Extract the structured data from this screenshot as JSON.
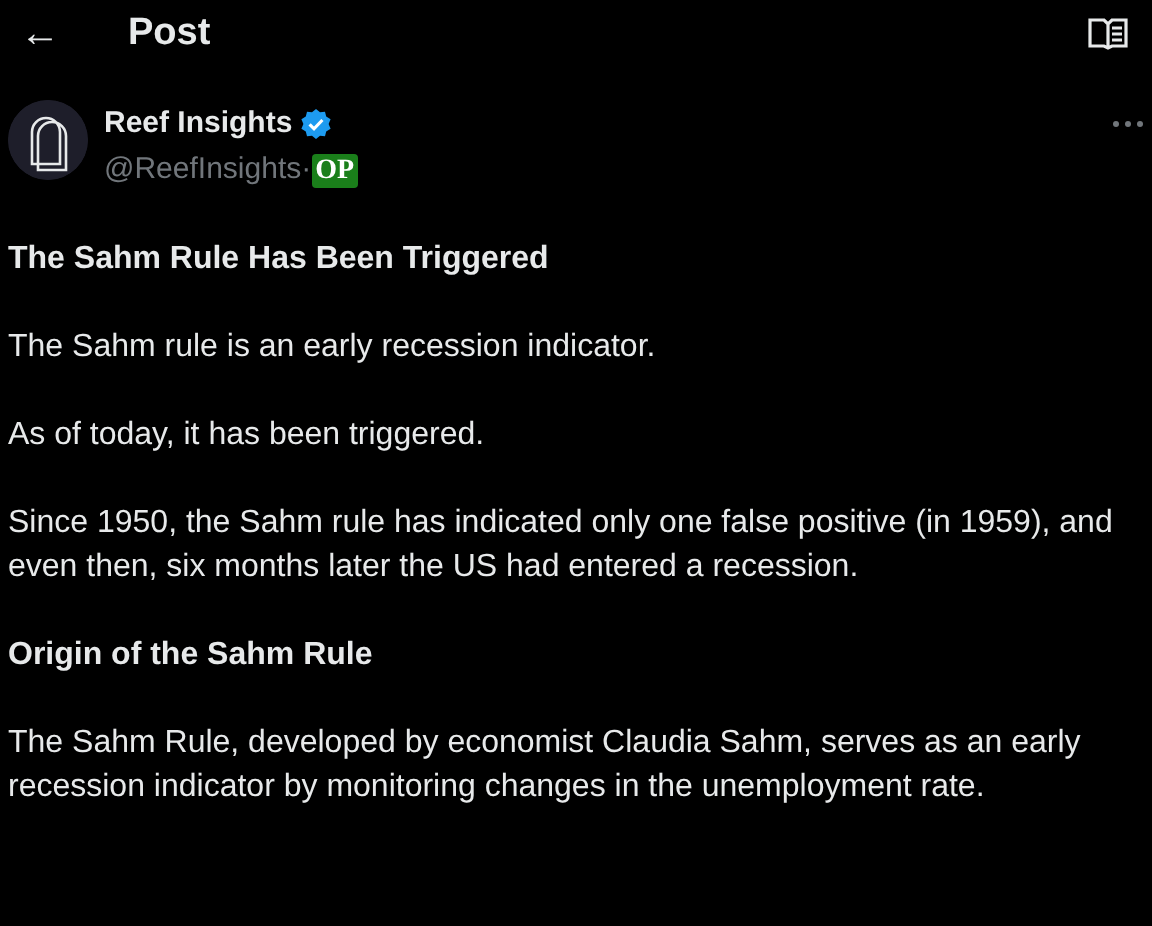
{
  "header": {
    "back_icon": "←",
    "title": "Post"
  },
  "author": {
    "name": "Reef Insights",
    "verified": true,
    "handle": "@ReefInsights·",
    "badge": "OP"
  },
  "body": [
    {
      "kind": "heading",
      "text": "The Sahm Rule Has Been Triggered"
    },
    {
      "kind": "paragraph",
      "text": "The Sahm rule is an early recession indicator."
    },
    {
      "kind": "paragraph",
      "text": "As of today, it has been triggered."
    },
    {
      "kind": "paragraph",
      "text": "Since 1950, the Sahm rule has indicated only one false positive (in 1959), and even then, six months later the US had entered a recession."
    },
    {
      "kind": "heading",
      "text": "Origin of the Sahm Rule"
    },
    {
      "kind": "paragraph",
      "text": "The Sahm Rule, developed by economist Claudia Sahm, serves as an early recession indicator by monitoring changes in the unemployment rate."
    }
  ]
}
